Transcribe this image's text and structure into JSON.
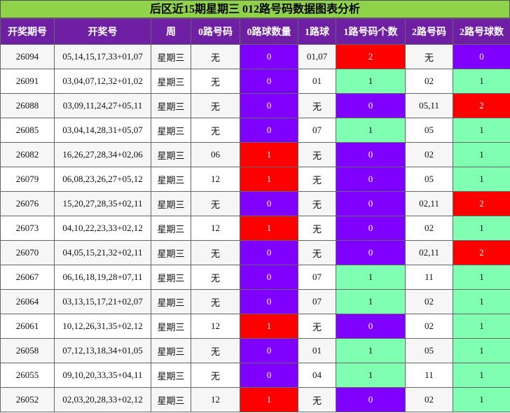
{
  "title": "后区近15期星期三 012路号码数据图表分析",
  "headers": [
    "开奖期号",
    "开奖号",
    "周",
    "0路号码",
    "0路球数量",
    "1路球",
    "1路号码个数",
    "2路号码",
    "2路号球数"
  ],
  "colors": {
    "purple": "#8000ff",
    "red": "#ff0000",
    "green": "#80ffb3",
    "header": "#6f1fa3",
    "title": "#8fd34a"
  },
  "rows": [
    [
      "26094",
      "05,14,15,17,33+01,07",
      "星期三",
      "无",
      "0",
      "01,07",
      "2",
      "无",
      "0"
    ],
    [
      "26091",
      "03,04,07,12,32+01,02",
      "星期三",
      "无",
      "0",
      "01",
      "1",
      "02",
      "1"
    ],
    [
      "26088",
      "03,09,11,24,27+05,11",
      "星期三",
      "无",
      "0",
      "无",
      "0",
      "05,11",
      "2"
    ],
    [
      "26085",
      "03,04,14,28,31+05,07",
      "星期三",
      "无",
      "0",
      "07",
      "1",
      "05",
      "1"
    ],
    [
      "26082",
      "16,26,27,28,34+02,06",
      "星期三",
      "06",
      "1",
      "无",
      "0",
      "02",
      "1"
    ],
    [
      "26079",
      "06,08,23,26,27+05,12",
      "星期三",
      "12",
      "1",
      "无",
      "0",
      "05",
      "1"
    ],
    [
      "26076",
      "15,20,27,28,35+02,11",
      "星期三",
      "无",
      "0",
      "无",
      "0",
      "02,11",
      "2"
    ],
    [
      "26073",
      "04,10,22,23,33+02,12",
      "星期三",
      "12",
      "1",
      "无",
      "0",
      "02",
      "1"
    ],
    [
      "26070",
      "04,05,15,21,32+02,11",
      "星期三",
      "无",
      "0",
      "无",
      "0",
      "02,11",
      "2"
    ],
    [
      "26067",
      "06,16,18,19,28+07,11",
      "星期三",
      "无",
      "0",
      "07",
      "1",
      "11",
      "1"
    ],
    [
      "26064",
      "03,13,15,17,21+02,07",
      "星期三",
      "无",
      "0",
      "07",
      "1",
      "02",
      "1"
    ],
    [
      "26061",
      "10,12,26,31,35+02,12",
      "星期三",
      "12",
      "1",
      "无",
      "0",
      "02",
      "1"
    ],
    [
      "26058",
      "07,12,13,18,34+01,05",
      "星期三",
      "无",
      "0",
      "01",
      "1",
      "05",
      "1"
    ],
    [
      "26055",
      "09,10,20,33,35+04,11",
      "星期三",
      "无",
      "0",
      "04",
      "1",
      "11",
      "1"
    ],
    [
      "26052",
      "02,03,20,28,33+02,12",
      "星期三",
      "12",
      "1",
      "无",
      "0",
      "02",
      "1"
    ]
  ]
}
